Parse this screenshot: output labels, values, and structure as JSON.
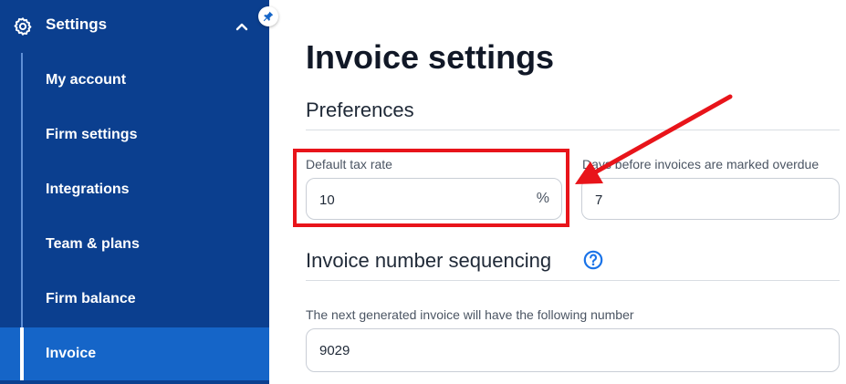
{
  "sidebar": {
    "header_title": "Settings",
    "items": [
      {
        "label": "My account"
      },
      {
        "label": "Firm settings"
      },
      {
        "label": "Integrations"
      },
      {
        "label": "Team & plans"
      },
      {
        "label": "Firm balance"
      },
      {
        "label": "Invoice",
        "active": true
      }
    ]
  },
  "main": {
    "title": "Invoice settings",
    "preferences": {
      "heading": "Preferences",
      "tax_rate": {
        "label": "Default tax rate",
        "value": "10",
        "suffix": "%"
      },
      "overdue_days": {
        "label": "Days before invoices are marked overdue",
        "value": "7"
      }
    },
    "sequencing": {
      "heading": "Invoice number sequencing",
      "next_number": {
        "label": "The next generated invoice will have the following number",
        "value": "9029"
      }
    }
  },
  "colors": {
    "sidebar_bg": "#0b3f8f",
    "sidebar_active": "#1565c8",
    "annotation_red": "#e8141a",
    "help_blue": "#1a73e8"
  },
  "icons": {
    "sidebar_header": "gear-icon",
    "collapse": "chevron-up-icon",
    "pin": "pin-icon",
    "help": "question-circle-icon"
  }
}
